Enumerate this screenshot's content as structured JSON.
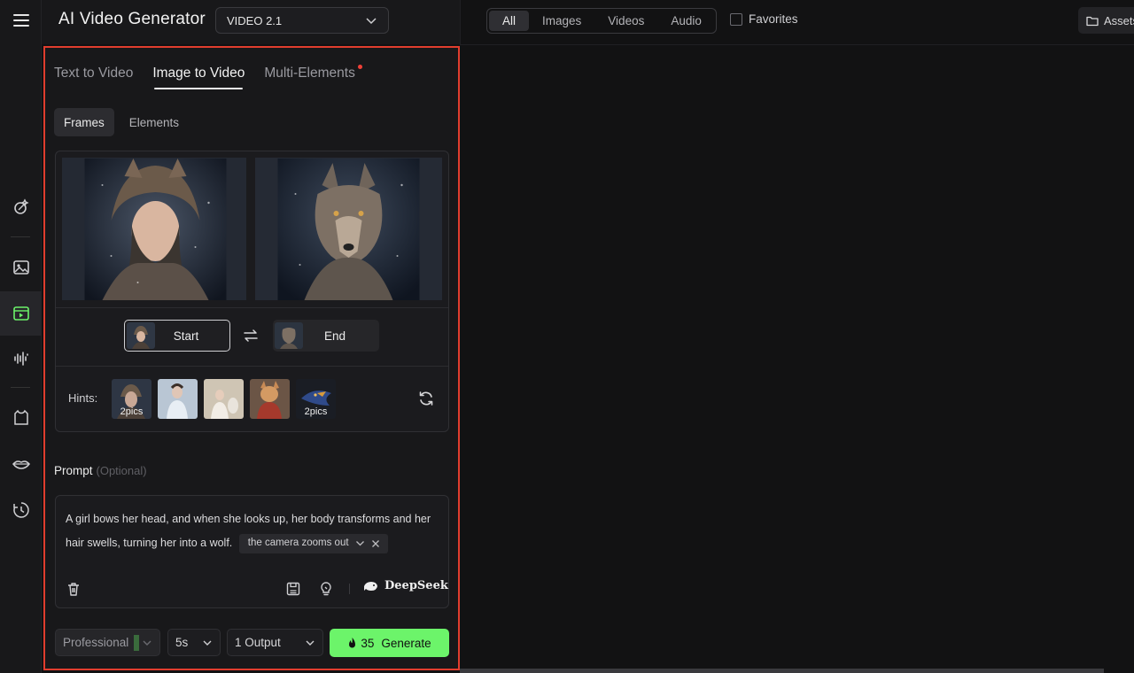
{
  "app": {
    "title": "AI Video Generator",
    "model": "VIDEO 2.1"
  },
  "rail": {
    "icons": [
      "menu-icon",
      "magic-brush-icon",
      "image-icon",
      "video-icon",
      "audio-wave-icon",
      "shirt-icon",
      "lips-icon",
      "history-icon"
    ],
    "active": "video-icon"
  },
  "tabs": [
    {
      "label": "Text to Video"
    },
    {
      "label": "Image to Video"
    },
    {
      "label": "Multi-Elements"
    }
  ],
  "subtabs": [
    {
      "label": "Frames"
    },
    {
      "label": "Elements"
    }
  ],
  "frames": {
    "start_label": "Start",
    "end_label": "End"
  },
  "hints": {
    "label": "Hints:",
    "items": [
      {
        "tag": "2pics"
      },
      {
        "tag": ""
      },
      {
        "tag": ""
      },
      {
        "tag": ""
      },
      {
        "tag": "2pics"
      }
    ]
  },
  "prompt": {
    "label": "Prompt",
    "optional": "(Optional)",
    "text": "A girl bows her head, and when she looks up, her body transforms and her hair swells, turning her into a wolf.",
    "chip": "the camera zooms out",
    "deepseek": "DeepSeek"
  },
  "controls": {
    "mode": "Professional",
    "duration": "5s",
    "outputs": "1 Output",
    "credits": "35",
    "generate": "Generate"
  },
  "library": {
    "filters": [
      "All",
      "Images",
      "Videos",
      "Audio"
    ],
    "active_filter": "All",
    "favorites": "Favorites",
    "assets": "Assets"
  },
  "colors": {
    "accent_green": "#6cf46a",
    "highlight_red": "#e13d2e"
  }
}
